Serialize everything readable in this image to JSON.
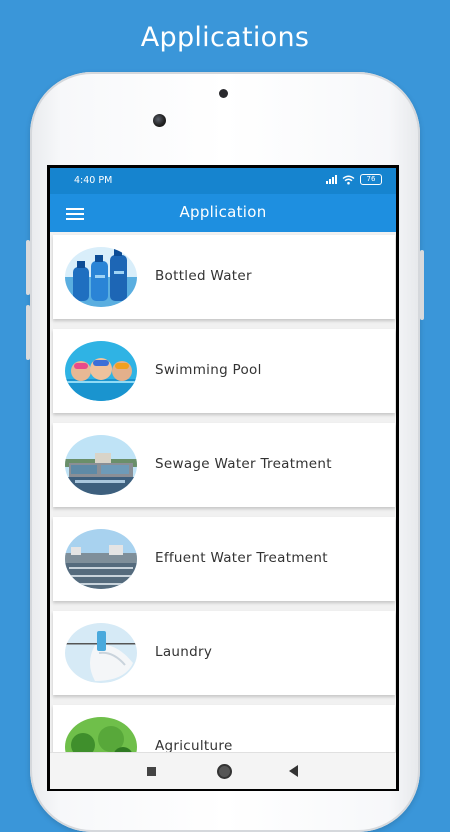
{
  "banner": {
    "title": "Applications"
  },
  "status_bar": {
    "time": "4:40 PM",
    "battery": "76"
  },
  "app_bar": {
    "title": "Application",
    "menu_icon": "hamburger-menu-icon"
  },
  "applications": [
    {
      "label": "Bottled Water",
      "image": "bottled-water-image"
    },
    {
      "label": "Swimming Pool",
      "image": "swimming-pool-image"
    },
    {
      "label": "Sewage Water Treatment",
      "image": "sewage-plant-image"
    },
    {
      "label": "Effuent Water Treatment",
      "image": "effluent-plant-image"
    },
    {
      "label": "Laundry",
      "image": "laundry-image"
    },
    {
      "label": "Agriculture",
      "image": "agriculture-image"
    }
  ],
  "nav_bar": {
    "recents_icon": "square-icon",
    "home_icon": "circle-home-icon",
    "back_icon": "triangle-back-icon"
  },
  "colors": {
    "background": "#3a96d9",
    "app_bar": "#1e8fe0",
    "status_bar": "#1684cf"
  }
}
